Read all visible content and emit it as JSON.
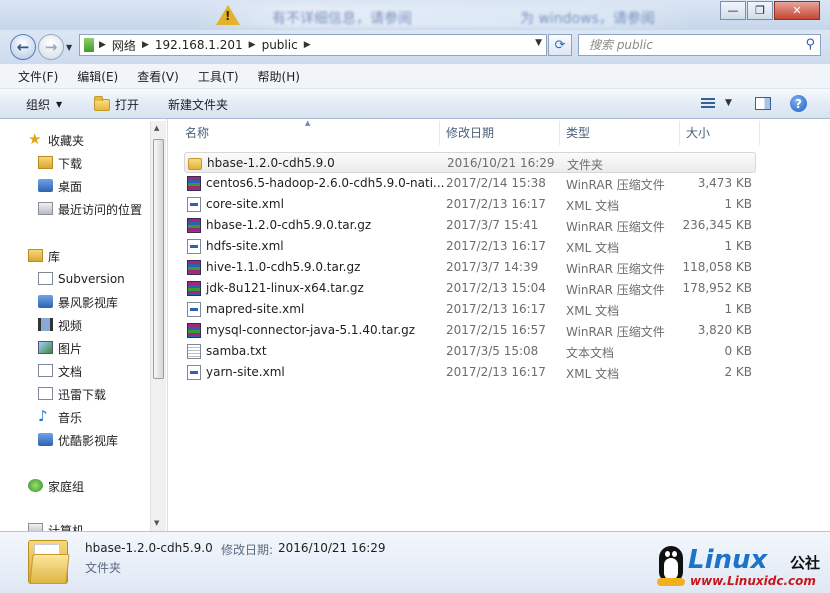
{
  "titlebar": {
    "blurred_text_1": "有不详细信息，请参阅",
    "blurred_text_2": "为 windows，请参阅"
  },
  "address": {
    "segments": [
      "网络",
      "192.168.1.201",
      "public"
    ],
    "search_placeholder": "搜索 public"
  },
  "menu": [
    "文件(F)",
    "编辑(E)",
    "查看(V)",
    "工具(T)",
    "帮助(H)"
  ],
  "toolbar": {
    "organize": "组织",
    "open": "打开",
    "new_folder": "新建文件夹"
  },
  "nav": {
    "favorites": "收藏夹",
    "favorites_items": [
      "下载",
      "桌面",
      "最近访问的位置"
    ],
    "libraries": "库",
    "libraries_items": [
      "Subversion",
      "暴风影视库",
      "视频",
      "图片",
      "文档",
      "迅雷下载",
      "音乐",
      "优酷影视库"
    ],
    "homegroup": "家庭组",
    "computer": "计算机"
  },
  "columns": {
    "name": "名称",
    "date": "修改日期",
    "type": "类型",
    "size": "大小"
  },
  "files": [
    {
      "name": "hbase-1.2.0-cdh5.9.0",
      "date": "2016/10/21 16:29",
      "type": "文件夹",
      "size": "",
      "icon": "folder"
    },
    {
      "name": "centos6.5-hadoop-2.6.0-cdh5.9.0-nati...",
      "date": "2017/2/14 15:38",
      "type": "WinRAR 压缩文件",
      "size": "3,473 KB",
      "icon": "rar"
    },
    {
      "name": "core-site.xml",
      "date": "2017/2/13 16:17",
      "type": "XML 文档",
      "size": "1 KB",
      "icon": "xml"
    },
    {
      "name": "hbase-1.2.0-cdh5.9.0.tar.gz",
      "date": "2017/3/7 15:41",
      "type": "WinRAR 压缩文件",
      "size": "236,345 KB",
      "icon": "rar"
    },
    {
      "name": "hdfs-site.xml",
      "date": "2017/2/13 16:17",
      "type": "XML 文档",
      "size": "1 KB",
      "icon": "xml"
    },
    {
      "name": "hive-1.1.0-cdh5.9.0.tar.gz",
      "date": "2017/3/7 14:39",
      "type": "WinRAR 压缩文件",
      "size": "118,058 KB",
      "icon": "rar"
    },
    {
      "name": "jdk-8u121-linux-x64.tar.gz",
      "date": "2017/2/13 15:04",
      "type": "WinRAR 压缩文件",
      "size": "178,952 KB",
      "icon": "rar"
    },
    {
      "name": "mapred-site.xml",
      "date": "2017/2/13 16:17",
      "type": "XML 文档",
      "size": "1 KB",
      "icon": "xml"
    },
    {
      "name": "mysql-connector-java-5.1.40.tar.gz",
      "date": "2017/2/15 16:57",
      "type": "WinRAR 压缩文件",
      "size": "3,820 KB",
      "icon": "rar"
    },
    {
      "name": "samba.txt",
      "date": "2017/3/5 15:08",
      "type": "文本文档",
      "size": "0 KB",
      "icon": "txt"
    },
    {
      "name": "yarn-site.xml",
      "date": "2017/2/13 16:17",
      "type": "XML 文档",
      "size": "2 KB",
      "icon": "xml"
    }
  ],
  "details": {
    "name": "hbase-1.2.0-cdh5.9.0",
    "modified_label": "修改日期:",
    "modified_value": "2016/10/21 16:29",
    "type": "文件夹"
  },
  "watermark": {
    "brand": "Linux",
    "cn": "公社",
    "url": "www.Linuxidc.com"
  },
  "colors": {
    "selection": "#ececec",
    "link_blue": "#1d73c9",
    "watermark_red": "#c8161d"
  }
}
